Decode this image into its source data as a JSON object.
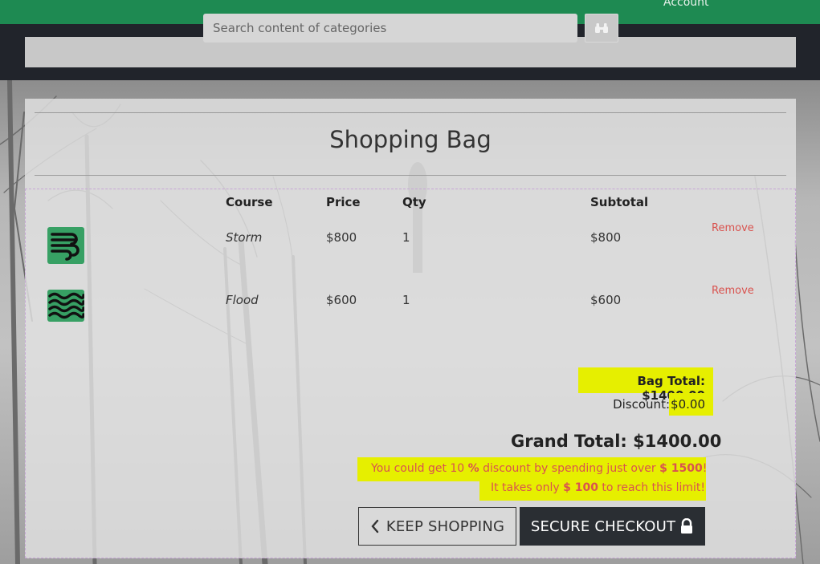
{
  "header": {
    "account_label": "Account"
  },
  "search": {
    "placeholder": "Search content of categories"
  },
  "bag": {
    "title": "Shopping Bag",
    "columns": {
      "course": "Course",
      "price": "Price",
      "qty": "Qty",
      "subtotal": "Subtotal"
    },
    "items": [
      {
        "course": "Storm",
        "price": "$800",
        "qty": "1",
        "subtotal": "$800",
        "remove": "Remove",
        "icon": "wind-icon"
      },
      {
        "course": "Flood",
        "price": "$600",
        "qty": "1",
        "subtotal": "$600",
        "remove": "Remove",
        "icon": "waves-icon"
      }
    ],
    "bag_total": "Bag Total: $1400.00",
    "discount_label": "Discount:",
    "discount_value": "$0.00",
    "grand_total": "Grand Total: $1400.00",
    "discount_note": {
      "p1": "You could get 10",
      "percent": "%",
      "p2": "discount by spending just over",
      "amount": "$ 1500",
      "p3": "!",
      "line2_p1": "It takes only",
      "line2_amount": "$ 100",
      "line2_p2": "to reach this limit!"
    },
    "keep_shopping": "KEEP SHOPPING",
    "checkout": "SECURE CHECKOUT"
  },
  "colors": {
    "brand_green": "#1e8a52",
    "icon_green": "#37a064",
    "dark_band": "#21242b",
    "remove_red": "#d9534f",
    "highlight": "#e6ef00",
    "checkout_bg": "#2a2e33"
  }
}
